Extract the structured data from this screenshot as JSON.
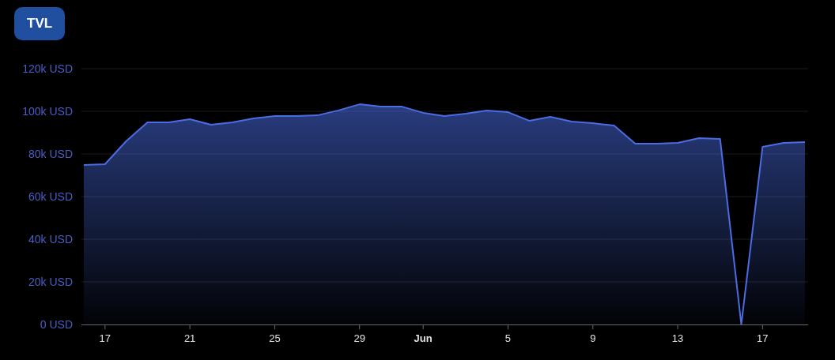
{
  "tabs": [
    {
      "label": "TVL",
      "selected": true
    }
  ],
  "chart": {
    "chart_data": {
      "type": "area",
      "categories": [
        null,
        "17",
        null,
        null,
        null,
        "21",
        null,
        null,
        null,
        "25",
        null,
        null,
        null,
        "29",
        null,
        null,
        "Jun",
        null,
        null,
        null,
        "5",
        null,
        null,
        null,
        "9",
        null,
        null,
        null,
        "13",
        null,
        null,
        null,
        "17",
        null,
        null
      ],
      "series": [
        {
          "color": "#4a6de5",
          "values": [
            74800,
            75200,
            86000,
            94800,
            94800,
            96300,
            93700,
            94800,
            96700,
            97800,
            97800,
            98100,
            100400,
            103300,
            102200,
            102200,
            99300,
            97800,
            98900,
            100400,
            99600,
            95600,
            97400,
            95200,
            94400,
            93300,
            84800,
            84800,
            85200,
            87400,
            87000,
            0,
            83300,
            85200,
            85600
          ]
        }
      ],
      "ylim": [
        0,
        120000
      ],
      "grid": true,
      "yticks": [
        {
          "value": 0,
          "label": "0 USD"
        },
        {
          "value": 20000,
          "label": "20k USD"
        },
        {
          "value": 40000,
          "label": "40k USD"
        },
        {
          "value": 60000,
          "label": "60k USD"
        },
        {
          "value": 80000,
          "label": "80k USD"
        },
        {
          "value": 100000,
          "label": "100k USD"
        },
        {
          "value": 120000,
          "label": "120k USD"
        }
      ]
    }
  }
}
